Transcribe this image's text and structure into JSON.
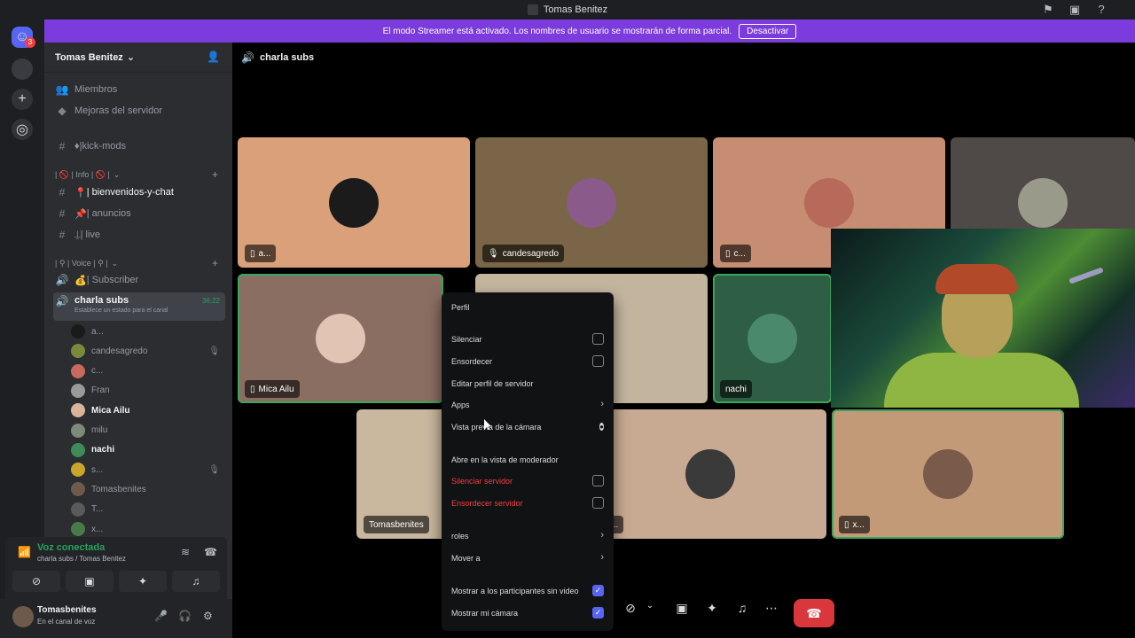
{
  "window": {
    "title": "Tomas Benitez"
  },
  "banner": {
    "text": "El modo Streamer está activado. Los nombres de usuario se mostrarán de forma parcial.",
    "button": "Desactivar"
  },
  "rail": {
    "badge": "3"
  },
  "server": {
    "name": "Tomas Benitez",
    "links": [
      {
        "label": "Miembros",
        "icon": "members-icon"
      },
      {
        "label": "Mejoras del servidor",
        "icon": "boost-icon"
      }
    ],
    "channels_top": [
      {
        "label": "♦|kick-mods"
      }
    ],
    "category_info": "| 🚫 | Info | 🚫 |",
    "info_channels": [
      {
        "label": "| bienvenidos-y-chat",
        "emoji": "📍"
      },
      {
        "label": "| anuncios",
        "emoji": "📌"
      },
      {
        "label": "| live",
        "emoji": "⍊"
      }
    ],
    "category_voice": "| ⚲ | Voice | ⚲ |",
    "voice_channels": [
      {
        "label": "| Subscriber",
        "emoji": "💰"
      }
    ],
    "active_voice": {
      "name": "charla subs",
      "time": "36:22",
      "status_hint": "Establece un estado para el canal"
    },
    "members": [
      {
        "name": "a...",
        "color": "#1a1a1a",
        "bold": false,
        "muted": false
      },
      {
        "name": "candesagredo",
        "color": "#7a8a3a",
        "bold": false,
        "muted": true
      },
      {
        "name": "c...",
        "color": "#c66a5a",
        "bold": false,
        "muted": false
      },
      {
        "name": "Fran",
        "color": "#9a9a9a",
        "bold": false,
        "muted": false
      },
      {
        "name": "Mica Ailu",
        "color": "#d9b49a",
        "bold": true,
        "muted": false
      },
      {
        "name": "milu",
        "color": "#7c8a7a",
        "bold": false,
        "muted": false
      },
      {
        "name": "nachi",
        "color": "#3f8a5a",
        "bold": true,
        "muted": false
      },
      {
        "name": "s...",
        "color": "#c7a62a",
        "bold": false,
        "muted": true
      },
      {
        "name": "Tomasbenites",
        "color": "#6d5a4a",
        "bold": false,
        "muted": false
      },
      {
        "name": "T...",
        "color": "#5a5a5a",
        "bold": false,
        "muted": false
      },
      {
        "name": "x...",
        "color": "#4a7a4a",
        "bold": false,
        "muted": false
      }
    ]
  },
  "voice_panel": {
    "status": "Voz conectada",
    "sub": "charla subs / Tomas Benitez"
  },
  "user_panel": {
    "name": "Tomasbenites",
    "sub": "En el canal de voz"
  },
  "stage": {
    "channel": "charla subs"
  },
  "tiles": [
    {
      "label": "a...",
      "bg": "#d9a07a",
      "pic": "#1b1b1b",
      "speaking": false,
      "icon": "phone-icon"
    },
    {
      "label": "candesagredo",
      "bg": "#7a6548",
      "pic": "#8a5a8a",
      "speaking": false,
      "icon": "mic-muted-icon"
    },
    {
      "label": "c...",
      "bg": "#c78d72",
      "pic": "#b86a5a",
      "speaking": false,
      "icon": "phone-icon"
    },
    {
      "label": "",
      "bg": "#4f4a48",
      "pic": "#9a9a8a",
      "speaking": false,
      "icon": ""
    },
    {
      "label": "Mica Ailu",
      "bg": "#8a6e62",
      "pic": "#e1c4b4",
      "speaking": true,
      "icon": "phone-icon"
    },
    {
      "label": "",
      "bg": "#c3b49e",
      "pic": "",
      "speaking": false,
      "icon": ""
    },
    {
      "label": "nachi",
      "bg": "#2e5e44",
      "pic": "#4a8a6a",
      "speaking": true,
      "icon": ""
    },
    {
      "label": "Tomasbenites",
      "bg": "#c9b79e",
      "pic": "",
      "speaking": false,
      "icon": ""
    },
    {
      "label": "T...",
      "bg": "#c8a992",
      "pic": "#3a3a3a",
      "speaking": false,
      "icon": ""
    },
    {
      "label": "x...",
      "bg": "#c39a78",
      "pic": "#7a5a4a",
      "speaking": true,
      "icon": "phone-icon"
    }
  ],
  "context_menu": {
    "profile": "Perfil",
    "mute": "Silenciar",
    "deafen": "Ensordecer",
    "edit_server_profile": "Editar perfil de servidor",
    "apps": "Apps",
    "camera_preview": "Vista previa de la cámara",
    "open_moderator_view": "Abre en la vista de moderador",
    "server_mute": "Silenciar servidor",
    "server_deafen": "Ensordecer servidor",
    "roles": "roles",
    "move_to": "Mover a",
    "show_non_video": "Mostrar a los participantes sin video",
    "show_my_camera": "Mostrar mi cámara"
  }
}
